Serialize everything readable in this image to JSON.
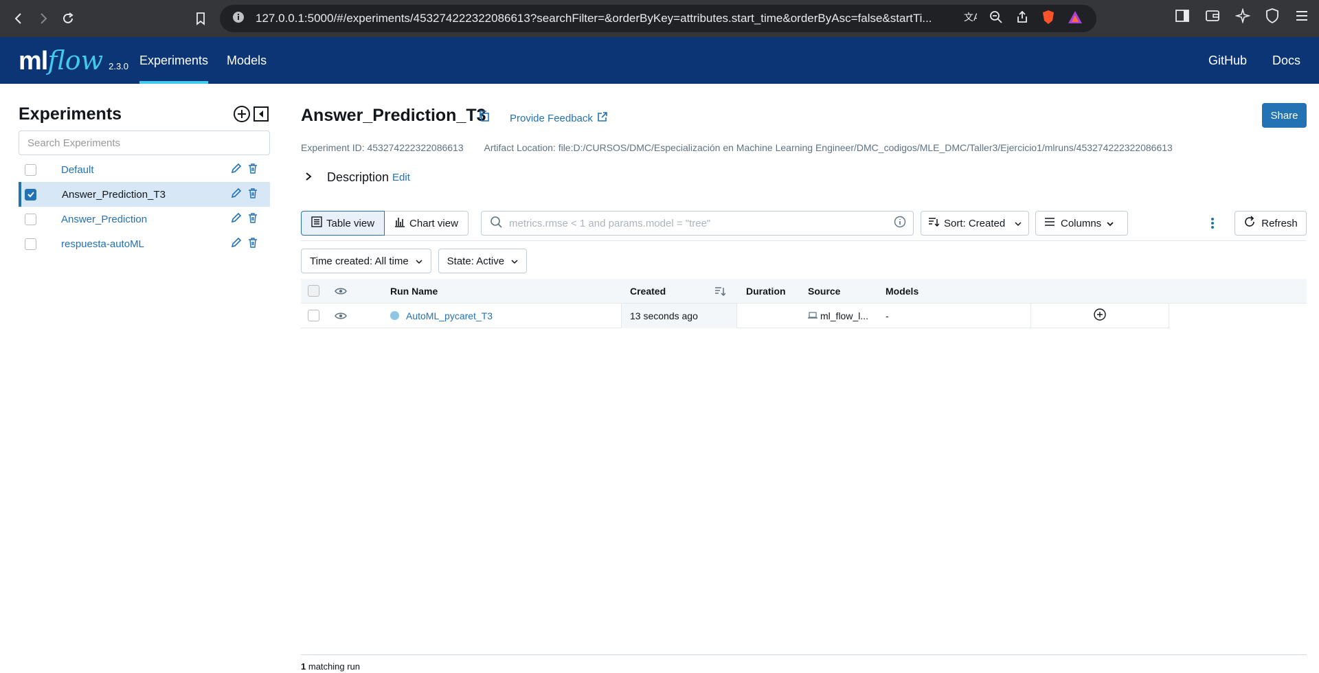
{
  "browser": {
    "url": "127.0.0.1:5000/#/experiments/453274222322086613?searchFilter=&orderByKey=attributes.start_time&orderByAsc=false&startTi..."
  },
  "header": {
    "logo_ml": "ml",
    "logo_flow": "flow",
    "version": "2.3.0",
    "nav": [
      "Experiments",
      "Models"
    ],
    "right_links": [
      "GitHub",
      "Docs"
    ]
  },
  "sidebar": {
    "title": "Experiments",
    "search_placeholder": "Search Experiments",
    "experiments": [
      {
        "name": "Default",
        "checked": false
      },
      {
        "name": "Answer_Prediction_T3",
        "checked": true
      },
      {
        "name": "Answer_Prediction",
        "checked": false
      },
      {
        "name": "respuesta-autoML",
        "checked": false
      }
    ]
  },
  "main": {
    "title": "Answer_Prediction_T3",
    "feedback": "Provide Feedback",
    "share": "Share",
    "experiment_id": "Experiment ID: 453274222322086613",
    "artifact_location": "Artifact Location: file:D:/CURSOS/DMC/Especialización en Machine Learning Engineer/DMC_codigos/MLE_DMC/Taller3/Ejercicio1/mlruns/453274222322086613",
    "description_label": "Description",
    "description_edit": "Edit",
    "table_view": "Table view",
    "chart_view": "Chart view",
    "filter_placeholder": "metrics.rmse < 1 and params.model = \"tree\"",
    "sort": "Sort: Created",
    "columns": "Columns",
    "refresh": "Refresh",
    "time_created": "Time created: All time",
    "state": "State: Active"
  },
  "table": {
    "headers": [
      "Run Name",
      "Created",
      "Duration",
      "Source",
      "Models"
    ],
    "rows": [
      {
        "run_name": "AutoML_pycaret_T3",
        "created": "13 seconds ago",
        "duration": "",
        "source": "ml_flow_l...",
        "models": "-"
      }
    ]
  },
  "footer": {
    "count": "1",
    "label": "matching run"
  },
  "colors": {
    "header_bg": "#0b3574",
    "accent": "#2272b4",
    "logo_flow": "#43c9ed",
    "selected_row": "#d8e7f5"
  }
}
